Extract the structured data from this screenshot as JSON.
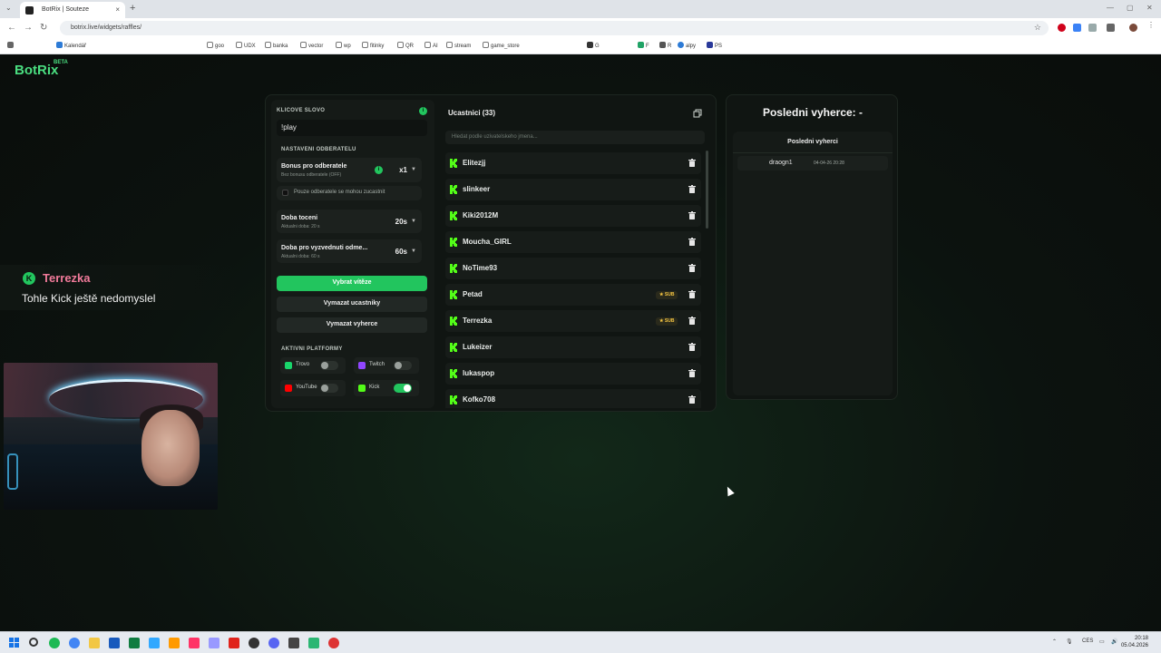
{
  "browser": {
    "tab_title": "BotRix | Souteze",
    "tab_close": "×",
    "new_tab": "+",
    "url": "botrix.live/widgets/raffles/",
    "bookmarks": [
      "Kalendář",
      "goo",
      "UDX",
      "banka",
      "vector",
      "wp",
      "fitinky",
      "QR",
      "AI",
      "stream",
      "game_store",
      "G",
      "F",
      "R",
      "alpy",
      "PS"
    ]
  },
  "app": {
    "logo": "BotRix",
    "logo_badge": "BETA"
  },
  "settings": {
    "keyword_label": "KLICOVE SLOVO",
    "keyword_value": "!play",
    "subs_section": "NASTAVENI ODBERATELU",
    "bonus_title": "Bonus pro odberatele",
    "bonus_sub": "Bez bonusu odberatele (OFF)",
    "bonus_value": "x1",
    "only_subs_label": "Pouze odberatele se mohou zucastnit",
    "spin_title": "Doba toceni",
    "spin_sub": "Aktualni doba: 20 s",
    "spin_value": "20s",
    "claim_title": "Doba pro vyzvednuti odme...",
    "claim_sub": "Aktualni doba: 60 s",
    "claim_value": "60s",
    "pick_winner": "Vybrat vítěze",
    "clear_participants": "Vymazat ucastniky",
    "clear_winners": "Vymazat vyherce",
    "platforms_section": "AKTIVNI PLATFORMY",
    "platforms": [
      {
        "name": "Trovo",
        "enabled": false,
        "color": "#19d66b"
      },
      {
        "name": "Twitch",
        "enabled": false,
        "color": "#9146ff"
      },
      {
        "name": "YouTube",
        "enabled": false,
        "color": "#ff0000"
      },
      {
        "name": "Kick",
        "enabled": true,
        "color": "#53fc18"
      }
    ]
  },
  "participants": {
    "header": "Ucastnici (33)",
    "search_placeholder": "Hledat podle uzivatelskeho jmena...",
    "sub_badge": "★ SUB",
    "list": [
      {
        "name": "Elitezjj",
        "sub": false
      },
      {
        "name": "slinkeer",
        "sub": false
      },
      {
        "name": "Kiki2012M",
        "sub": false
      },
      {
        "name": "Moucha_GIRL",
        "sub": false
      },
      {
        "name": "NoTime93",
        "sub": false
      },
      {
        "name": "Petad",
        "sub": true
      },
      {
        "name": "Terrezka",
        "sub": true
      },
      {
        "name": "Lukeizer",
        "sub": false
      },
      {
        "name": "lukaspop",
        "sub": false
      },
      {
        "name": "Kofko708",
        "sub": false
      }
    ]
  },
  "winners": {
    "title": "Posledni vyherce: -",
    "list_header": "Posledni vyherci",
    "entries": [
      {
        "name": "draogn1",
        "date": "04-04-26 20:28"
      }
    ]
  },
  "chat": {
    "user": "Terrezka",
    "message": "Tohle Kick ještě nedomyslel"
  },
  "taskbar": {
    "lang": "CES",
    "time": "20:18",
    "date": "05.04.2026"
  }
}
